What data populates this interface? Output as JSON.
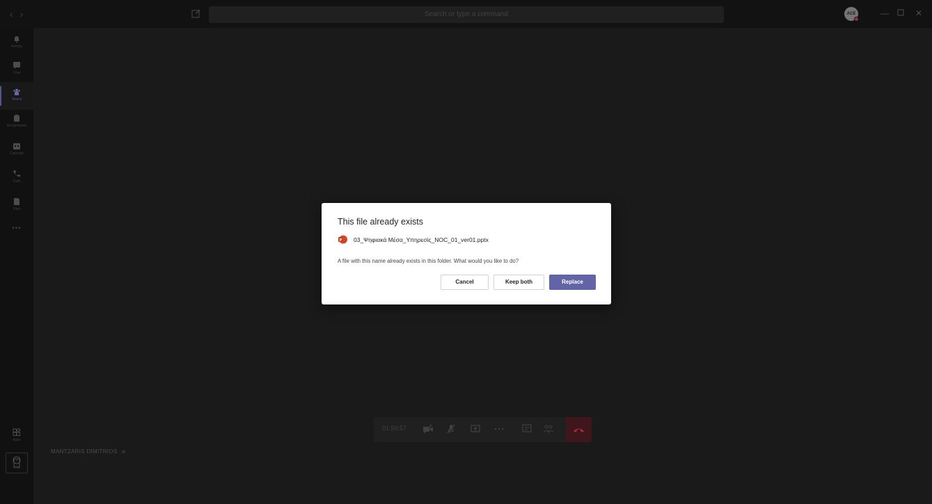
{
  "titlebar": {
    "search_placeholder": "Search or type a command",
    "avatar_initials": "ACE"
  },
  "rail": {
    "items": [
      {
        "label": "Activity",
        "icon": "bell-icon"
      },
      {
        "label": "Chat",
        "icon": "chat-icon"
      },
      {
        "label": "Teams",
        "icon": "teams-icon",
        "active": true
      },
      {
        "label": "Assignments",
        "icon": "assignments-icon"
      },
      {
        "label": "Calendar",
        "icon": "calendar-icon"
      },
      {
        "label": "Calls",
        "icon": "phone-icon"
      },
      {
        "label": "Files",
        "icon": "files-icon"
      }
    ],
    "more": "•••",
    "bottom": [
      {
        "label": "Apps",
        "icon": "apps-icon"
      },
      {
        "label": "Help",
        "icon": "help-icon"
      }
    ]
  },
  "stage": {
    "participant_name": "MANTZARIS DIMITRIOS"
  },
  "call": {
    "timer": "01:50:57"
  },
  "dialog": {
    "title": "This file already exists",
    "file_name": "03_Ψηφιακά Μέσα_Υπηρεσίς_NOC_01_ver01.pptx",
    "message": "A file with this name already exists in this folder. What would you like to do?",
    "cancel_label": "Cancel",
    "keep_both_label": "Keep both",
    "replace_label": "Replace"
  },
  "colors": {
    "accent": "#6264a7",
    "hangup": "#c4314b",
    "ppt": "#d24726"
  }
}
